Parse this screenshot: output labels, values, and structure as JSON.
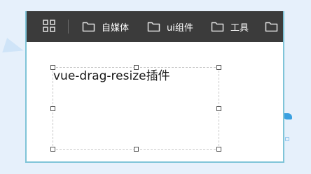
{
  "colors": {
    "page_background": "#e6f0fb",
    "toolbar_background": "#3b3b3b",
    "window_border": "#7fc4d8",
    "handle_border": "#555555",
    "box_dashed_border": "#c8c8c8"
  },
  "bookmarks_bar": {
    "apps_icon": "apps-grid-icon",
    "items": [
      {
        "icon": "folder-icon",
        "label": "自媒体"
      },
      {
        "icon": "folder-icon",
        "label": "ui组件"
      },
      {
        "icon": "folder-icon",
        "label": "工具"
      },
      {
        "icon": "folder-icon",
        "label": ""
      }
    ]
  },
  "drag_box": {
    "text": "vue-drag-resize插件",
    "handles": [
      "top-left",
      "top-middle",
      "top-right",
      "middle-left",
      "middle-right",
      "bottom-left",
      "bottom-middle",
      "bottom-right"
    ]
  }
}
